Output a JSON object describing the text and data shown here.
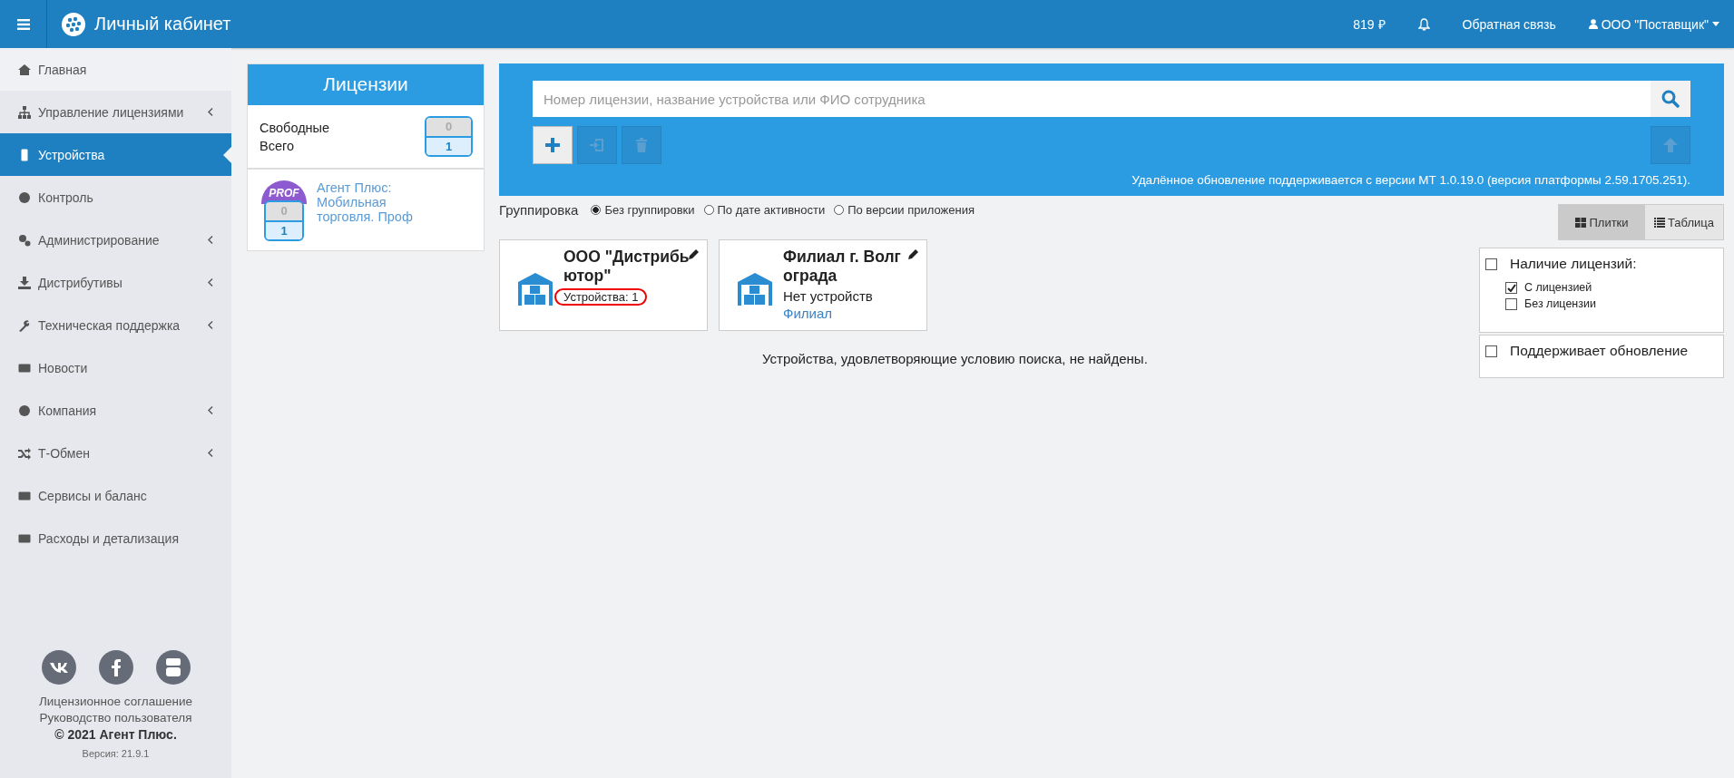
{
  "header": {
    "title": "Личный кабинет",
    "balance": "819 ₽",
    "feedback": "Обратная связь",
    "user": "ООО \"Поставщик\""
  },
  "sidebar": {
    "items": [
      {
        "label": "Главная",
        "selected": false,
        "has_submenu": false
      },
      {
        "label": "Управление лицензиями",
        "selected": false,
        "has_submenu": true
      },
      {
        "label": "Устройства",
        "selected": true,
        "has_submenu": false
      },
      {
        "label": "Контроль",
        "selected": false,
        "has_submenu": false
      },
      {
        "label": "Администрирование",
        "selected": false,
        "has_submenu": true
      },
      {
        "label": "Дистрибутивы",
        "selected": false,
        "has_submenu": true
      },
      {
        "label": "Техническая поддержка",
        "selected": false,
        "has_submenu": true
      },
      {
        "label": "Новости",
        "selected": false,
        "has_submenu": false
      },
      {
        "label": "Компания",
        "selected": false,
        "has_submenu": true
      },
      {
        "label": "Т-Обмен",
        "selected": false,
        "has_submenu": true
      },
      {
        "label": "Сервисы и баланс",
        "selected": false,
        "has_submenu": false
      },
      {
        "label": "Расходы и детализация",
        "selected": false,
        "has_submenu": false
      }
    ],
    "footer": {
      "links": [
        "Лицензионное соглашение",
        "Руководство пользователя"
      ],
      "copyright": "© 2021 Агент Плюс.",
      "version": "Версия: 21.9.1"
    }
  },
  "licenses": {
    "title": "Лицензии",
    "free_label": "Свободные",
    "total_label": "Всего",
    "free": "0",
    "total": "1",
    "products": [
      {
        "badge": "PROF",
        "free": "0",
        "total": "1",
        "name": "Агент Плюс: Мобильная торговля. Проф"
      }
    ]
  },
  "search": {
    "placeholder": "Номер лицензии, название устройства или ФИО сотрудника",
    "toolbar": [
      {
        "kind": "add",
        "disabled": false
      },
      {
        "kind": "import",
        "disabled": true
      },
      {
        "kind": "delete",
        "disabled": true
      }
    ],
    "update_disabled": true,
    "note": "Удалённое обновление поддерживается с версии МТ 1.0.19.0 (версия платформы 2.59.1705.251)."
  },
  "grouping": {
    "label": "Группировка",
    "options": [
      {
        "label": "Без группировки",
        "selected": true
      },
      {
        "label": "По дате активности",
        "selected": false
      },
      {
        "label": "По версии приложения",
        "selected": false
      }
    ]
  },
  "view_toggle": [
    {
      "label": "Плитки",
      "kind": "tiles",
      "selected": true
    },
    {
      "label": "Таблица",
      "kind": "table",
      "selected": false
    }
  ],
  "cards": [
    {
      "title": "ООО \"Дистрибьютор\"",
      "subtitle": "Устройства: 1",
      "highlighted": true
    },
    {
      "title": "Филиал г. Волгограда",
      "subtitle": "Нет устройств",
      "link": "Филиал",
      "highlighted": false
    }
  ],
  "empty_message": "Устройства, удовлетворяющие условию поиска, не найдены.",
  "filters": [
    {
      "label": "Наличие лицензий:",
      "checked": false,
      "options": [
        {
          "label": "С лицензией",
          "checked": true
        },
        {
          "label": "Без лицензии",
          "checked": false
        }
      ]
    },
    {
      "label": "Поддерживает обновление",
      "checked": false
    }
  ]
}
